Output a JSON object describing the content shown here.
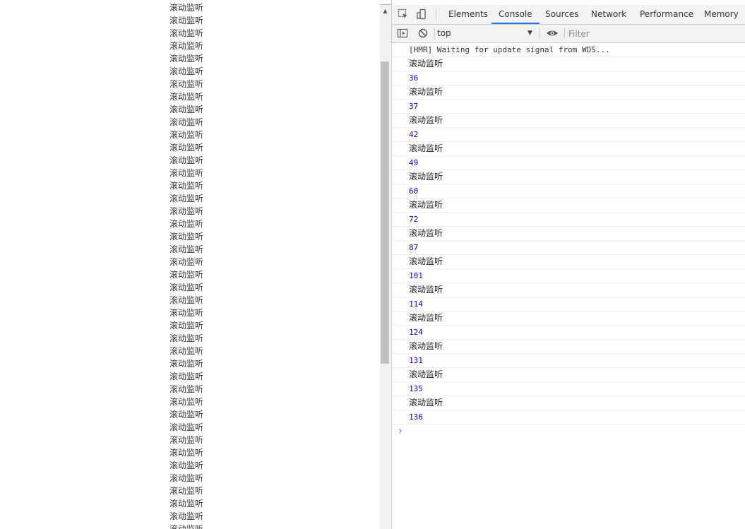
{
  "page": {
    "repeat_text": "滚动监听",
    "items": [
      "滚动监听",
      "滚动监听",
      "滚动监听",
      "滚动监听",
      "滚动监听",
      "滚动监听",
      "滚动监听",
      "滚动监听",
      "滚动监听",
      "滚动监听",
      "滚动监听",
      "滚动监听",
      "滚动监听",
      "滚动监听",
      "滚动监听",
      "滚动监听",
      "滚动监听",
      "滚动监听",
      "滚动监听",
      "滚动监听",
      "滚动监听",
      "滚动监听",
      "滚动监听",
      "滚动监听",
      "滚动监听",
      "滚动监听",
      "滚动监听",
      "滚动监听",
      "滚动监听",
      "滚动监听",
      "滚动监听",
      "滚动监听",
      "滚动监听",
      "滚动监听",
      "滚动监听",
      "滚动监听",
      "滚动监听",
      "滚动监听",
      "滚动监听",
      "滚动监听",
      "滚动监听",
      "滚动监听"
    ]
  },
  "devtools": {
    "tabs": [
      "Elements",
      "Console",
      "Sources",
      "Network",
      "Performance",
      "Memory"
    ],
    "active_tab": "Console",
    "context": "top",
    "filter_placeholder": "Filter",
    "accent_color": "#1a73e8",
    "number_color": "#1c00cf",
    "console_lines": [
      {
        "kind": "mono",
        "text": "[HMR] Waiting for update signal from WDS..."
      },
      {
        "kind": "text",
        "text": "滚动监听"
      },
      {
        "kind": "num",
        "text": "36"
      },
      {
        "kind": "text",
        "text": "滚动监听"
      },
      {
        "kind": "num",
        "text": "37"
      },
      {
        "kind": "text",
        "text": "滚动监听"
      },
      {
        "kind": "num",
        "text": "42"
      },
      {
        "kind": "text",
        "text": "滚动监听"
      },
      {
        "kind": "num",
        "text": "49"
      },
      {
        "kind": "text",
        "text": "滚动监听"
      },
      {
        "kind": "num",
        "text": "60"
      },
      {
        "kind": "text",
        "text": "滚动监听"
      },
      {
        "kind": "num",
        "text": "72"
      },
      {
        "kind": "text",
        "text": "滚动监听"
      },
      {
        "kind": "num",
        "text": "87"
      },
      {
        "kind": "text",
        "text": "滚动监听"
      },
      {
        "kind": "num",
        "text": "101"
      },
      {
        "kind": "text",
        "text": "滚动监听"
      },
      {
        "kind": "num",
        "text": "114"
      },
      {
        "kind": "text",
        "text": "滚动监听"
      },
      {
        "kind": "num",
        "text": "124"
      },
      {
        "kind": "text",
        "text": "滚动监听"
      },
      {
        "kind": "num",
        "text": "131"
      },
      {
        "kind": "text",
        "text": "滚动监听"
      },
      {
        "kind": "num",
        "text": "135"
      },
      {
        "kind": "text",
        "text": "滚动监听"
      },
      {
        "kind": "num",
        "text": "136"
      }
    ],
    "prompt_symbol": "›"
  }
}
